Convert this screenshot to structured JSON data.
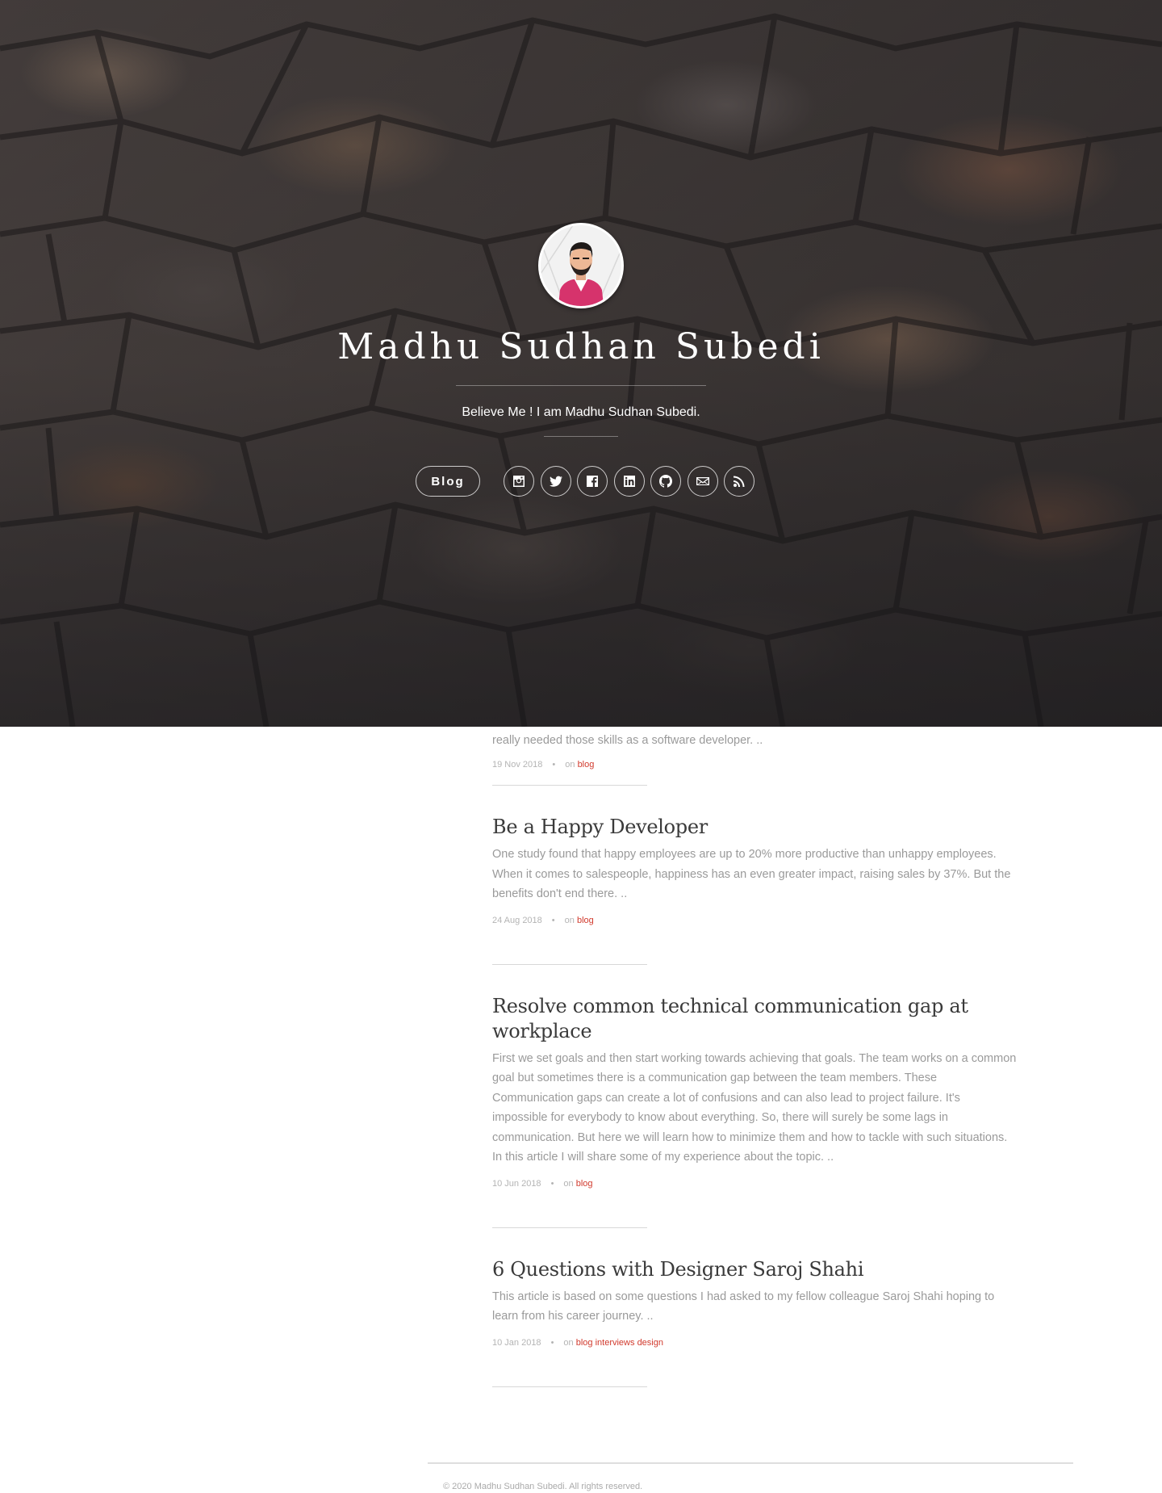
{
  "site": {
    "title": "Madhu Sudhan Subedi",
    "tagline": "Believe Me ! I am Madhu Sudhan Subedi."
  },
  "nav": {
    "blog_label": "Blog",
    "social_icons": [
      "instagram-icon",
      "twitter-icon",
      "facebook-icon",
      "linkedin-icon",
      "github-icon",
      "email-icon",
      "rss-icon"
    ]
  },
  "posts": {
    "partial": {
      "excerpt_tail": "really needed those skills as a software developer. ..",
      "date": "19 Nov 2018",
      "on": "on",
      "tags": [
        "blog"
      ]
    },
    "items": [
      {
        "title": "Be a Happy Developer",
        "excerpt": "One study found that happy employees are up to 20% more productive than unhappy employees. When it comes to salespeople, happiness has an even greater impact, raising sales by 37%. But the benefits don't end there. ..",
        "date": "24 Aug 2018",
        "on": "on",
        "tags": [
          "blog"
        ]
      },
      {
        "title": "Resolve common technical communication gap at workplace",
        "excerpt": "First we set goals and then start working towards achieving that goals. The team works on a common goal but sometimes there is a communication gap between the team members. These Communication gaps can create a lot of confusions and can also lead to project failure. It's impossible for everybody to know about everything. So, there will surely be some lags in communication. But here we will learn how to minimize them and how to tackle with such situations. In this article I will share some of my experience about the topic. ..",
        "date": "10 Jun 2018",
        "on": "on",
        "tags": [
          "blog"
        ]
      },
      {
        "title": "6 Questions with Designer Saroj Shahi",
        "excerpt": "This article is based on some questions I had asked to my fellow colleague Saroj Shahi hoping to learn from his career journey. ..",
        "date": "10 Jan 2018",
        "on": "on",
        "tags": [
          "blog",
          "interviews",
          "design"
        ]
      }
    ],
    "separator": "•"
  },
  "footer": {
    "copyright": "© 2020 Madhu Sudhan Subedi. All rights reserved."
  },
  "colors": {
    "accent": "#d13a2d",
    "excerpt": "#9a9a9a",
    "title": "#3a3a3a"
  }
}
